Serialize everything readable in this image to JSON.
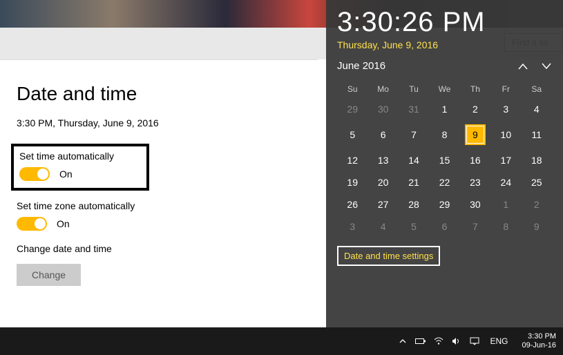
{
  "header": {
    "search_placeholder": "Find a se"
  },
  "settings": {
    "title": "Date and time",
    "current": "3:30 PM, Thursday, June 9, 2016",
    "auto_time": {
      "label": "Set time automatically",
      "state": "On"
    },
    "auto_tz": {
      "label": "Set time zone automatically",
      "state": "On"
    },
    "change": {
      "heading": "Change date and time",
      "button": "Change"
    }
  },
  "flyout": {
    "time": "3:30:26 PM",
    "date": "Thursday, June 9, 2016",
    "month": "June 2016",
    "weekdays": [
      "Su",
      "Mo",
      "Tu",
      "We",
      "Th",
      "Fr",
      "Sa"
    ],
    "weeks": [
      [
        {
          "d": "29",
          "dim": true
        },
        {
          "d": "30",
          "dim": true
        },
        {
          "d": "31",
          "dim": true
        },
        {
          "d": "1"
        },
        {
          "d": "2"
        },
        {
          "d": "3"
        },
        {
          "d": "4"
        }
      ],
      [
        {
          "d": "5"
        },
        {
          "d": "6"
        },
        {
          "d": "7"
        },
        {
          "d": "8"
        },
        {
          "d": "9",
          "today": true
        },
        {
          "d": "10"
        },
        {
          "d": "11"
        }
      ],
      [
        {
          "d": "12"
        },
        {
          "d": "13"
        },
        {
          "d": "14"
        },
        {
          "d": "15"
        },
        {
          "d": "16"
        },
        {
          "d": "17"
        },
        {
          "d": "18"
        }
      ],
      [
        {
          "d": "19"
        },
        {
          "d": "20"
        },
        {
          "d": "21"
        },
        {
          "d": "22"
        },
        {
          "d": "23"
        },
        {
          "d": "24"
        },
        {
          "d": "25"
        }
      ],
      [
        {
          "d": "26"
        },
        {
          "d": "27"
        },
        {
          "d": "28"
        },
        {
          "d": "29"
        },
        {
          "d": "30"
        },
        {
          "d": "1",
          "dim": true
        },
        {
          "d": "2",
          "dim": true
        }
      ],
      [
        {
          "d": "3",
          "dim": true
        },
        {
          "d": "4",
          "dim": true
        },
        {
          "d": "5",
          "dim": true
        },
        {
          "d": "6",
          "dim": true
        },
        {
          "d": "7",
          "dim": true
        },
        {
          "d": "8",
          "dim": true
        },
        {
          "d": "9",
          "dim": true
        }
      ]
    ],
    "settings_link": "Date and time settings"
  },
  "taskbar": {
    "lang": "ENG",
    "clock_time": "3:30 PM",
    "clock_date": "09-Jun-16"
  }
}
